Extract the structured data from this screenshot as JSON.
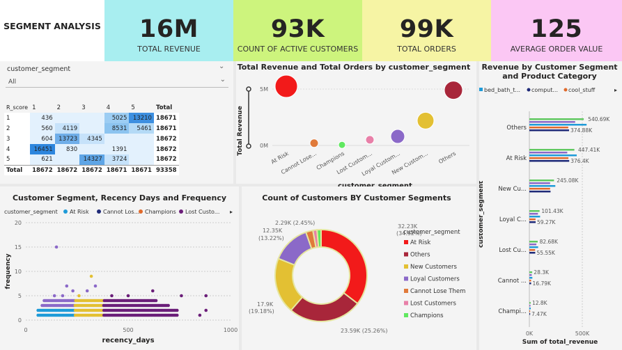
{
  "header": {
    "title": "SEGMENT ANALYSIS"
  },
  "kpis": [
    {
      "value": "16M",
      "label": "TOTAL REVENUE",
      "color": "#a8eef0"
    },
    {
      "value": "93K",
      "label": "COUNT OF ACTIVE CUSTOMERS",
      "color": "#cdf47d"
    },
    {
      "value": "99K",
      "label": "TOTAL ORDERS",
      "color": "#f6f4a4"
    },
    {
      "value": "125",
      "label": "AVERAGE ORDER VALUE",
      "color": "#fbc7f4"
    }
  ],
  "slicer": {
    "field": "customer_segment",
    "value": "All"
  },
  "matrix": {
    "headers": [
      "R_score",
      "1",
      "2",
      "3",
      "4",
      "5",
      "Total"
    ],
    "rows": [
      {
        "label": "1",
        "cells": [
          "436",
          "",
          "",
          "5025",
          "13210"
        ],
        "total": "18671"
      },
      {
        "label": "2",
        "cells": [
          "560",
          "4119",
          "",
          "8531",
          "5461"
        ],
        "total": "18671"
      },
      {
        "label": "3",
        "cells": [
          "604",
          "13723",
          "4345",
          "",
          ""
        ],
        "total": "18672"
      },
      {
        "label": "4",
        "cells": [
          "16451",
          "830",
          "",
          "1391",
          ""
        ],
        "total": "18672"
      },
      {
        "label": "5",
        "cells": [
          "621",
          "",
          "14327",
          "3724",
          ""
        ],
        "total": "18672"
      }
    ],
    "totals": {
      "label": "Total",
      "cells": [
        "18672",
        "18672",
        "18672",
        "18671",
        "18671"
      ],
      "total": "93358"
    }
  },
  "bubble": {
    "title": "Total Revenue and Total Orders by customer_segment",
    "ylabel": "Total Revenue",
    "xlabel": "customer_segment",
    "yticks": [
      "0M",
      "5M"
    ],
    "categories": [
      "At Risk",
      "Cannot Lose...",
      "Champions",
      "Lost Custom...",
      "Loyal Custom...",
      "New Custom...",
      "Others"
    ]
  },
  "scatter": {
    "title": "Customer Segment, Recency Days and Frequency",
    "legend_title": "customer_segment",
    "legend": [
      {
        "name": "At Risk",
        "color": "#1f9bd8"
      },
      {
        "name": "Cannot Los...",
        "color": "#e06a2c"
      },
      {
        "name": "Champions",
        "color": "#e06a2c"
      },
      {
        "name": "Lost Custo...",
        "color": "#6b1e79"
      }
    ],
    "xlabel": "recency_days",
    "ylabel": "frequency",
    "xticks": [
      "0",
      "500",
      "1000"
    ],
    "yticks": [
      "0",
      "5",
      "10",
      "15",
      "20"
    ]
  },
  "donut": {
    "title": "Count of Customers BY Customer Segments",
    "legend_title": "customer_segment",
    "labels": {
      "a": "32.23K",
      "a2": "(34.52%)",
      "b": "23.59K (25.26%)",
      "c": "17.9K",
      "c2": "(19.18%)",
      "d": "12.35K",
      "d2": "(13.22%)",
      "e": "2.29K (2.45%)"
    }
  },
  "hbar": {
    "title": "Revenue by Customer Segment and Product Category",
    "legend": [
      {
        "name": "bed_bath_t...",
        "color": "#1f9bd8"
      },
      {
        "name": "comput...",
        "color": "#1f2a78"
      },
      {
        "name": "cool_stuff",
        "color": "#e06a2c"
      }
    ],
    "ylabel": "customer_segment",
    "xlabel": "Sum of total_revenue",
    "xticks": [
      "0K",
      "500K"
    ],
    "groups": [
      {
        "name": "Others",
        "labels": [
          "540.69K",
          "374.88K"
        ]
      },
      {
        "name": "At Risk",
        "labels": [
          "447.41K",
          "376.4K"
        ]
      },
      {
        "name": "New Cu...",
        "labels": [
          "245.08K"
        ]
      },
      {
        "name": "Loyal C...",
        "labels": [
          "101.43K",
          "59.27K"
        ]
      },
      {
        "name": "Lost Cu...",
        "labels": [
          "82.68K",
          "55.55K"
        ]
      },
      {
        "name": "Cannot ...",
        "labels": [
          "28.3K",
          "16.79K"
        ]
      },
      {
        "name": "Champi...",
        "labels": [
          "12.8K",
          "7.47K"
        ]
      }
    ]
  },
  "chart_data": [
    {
      "type": "table",
      "title": "",
      "columns": [
        "R_score",
        "1",
        "2",
        "3",
        "4",
        "5",
        "Total"
      ],
      "rows": [
        [
          "1",
          "436",
          "",
          "",
          "5025",
          "13210",
          "18671"
        ],
        [
          "2",
          "560",
          "4119",
          "",
          "8531",
          "5461",
          "18671"
        ],
        [
          "3",
          "604",
          "13723",
          "4345",
          "",
          "",
          "18672"
        ],
        [
          "4",
          "16451",
          "830",
          "",
          "1391",
          "",
          "18672"
        ],
        [
          "5",
          "621",
          "",
          "14327",
          "3724",
          "",
          "18672"
        ],
        [
          "Total",
          "18672",
          "18672",
          "18672",
          "18671",
          "18671",
          "93358"
        ]
      ]
    },
    {
      "type": "scatter",
      "title": "Total Revenue and Total Orders by customer_segment",
      "xlabel": "customer_segment",
      "ylabel": "Total Revenue",
      "categories": [
        "At Risk",
        "Cannot Lose...",
        "Champions",
        "Lost Custom...",
        "Loyal Custom...",
        "New Custom...",
        "Others"
      ],
      "values": [
        5.3,
        0.2,
        0.05,
        0.5,
        0.8,
        2.2,
        4.9
      ],
      "ylim": [
        0,
        6
      ]
    },
    {
      "type": "scatter",
      "title": "Customer Segment, Recency Days and Frequency",
      "xlabel": "recency_days",
      "ylabel": "frequency",
      "xlim": [
        0,
        1000
      ],
      "ylim": [
        0,
        20
      ],
      "series": [
        {
          "name": "At Risk",
          "color": "#1f9bd8",
          "x_range": [
            150,
            620
          ],
          "y_values": [
            1,
            2,
            3
          ]
        },
        {
          "name": "Lost Custo...",
          "color": "#6b1e79",
          "x_range": [
            400,
            740
          ],
          "y_values": [
            1,
            2,
            3,
            4
          ]
        },
        {
          "name": "Champions",
          "color": "#e8c31b",
          "x_range": [
            240,
            380
          ],
          "y_values": [
            1,
            2,
            3,
            4,
            5
          ]
        }
      ]
    },
    {
      "type": "pie",
      "title": "Count of Customers BY Customer Segments",
      "categories": [
        "At Risk",
        "Others",
        "New Customers",
        "Loyal Customers",
        "Cannot Lose Them",
        "Lost Customers",
        "Champions"
      ],
      "values": [
        32.23,
        23.59,
        17.9,
        12.35,
        2.29,
        1.3,
        1.3
      ],
      "colors": [
        "#f21a1a",
        "#a8263a",
        "#e3c033",
        "#8b69c8",
        "#e07a3a",
        "#e880a8",
        "#60e860"
      ]
    },
    {
      "type": "bar",
      "title": "Revenue by Customer Segment and Product Category",
      "xlabel": "Sum of total_revenue",
      "ylabel": "customer_segment",
      "categories": [
        "Others",
        "At Risk",
        "New Cu...",
        "Loyal C...",
        "Lost Cu...",
        "Cannot ...",
        "Champi..."
      ],
      "series": [
        {
          "name": "bed_bath_t...",
          "values": [
            540.69,
            447.41,
            245.08,
            101.43,
            82.68,
            28.3,
            12.8
          ]
        },
        {
          "name": "comput...",
          "values": [
            374.88,
            376.4,
            200,
            59.27,
            55.55,
            16.79,
            7.47
          ]
        }
      ],
      "xlim": [
        0,
        600
      ]
    }
  ]
}
